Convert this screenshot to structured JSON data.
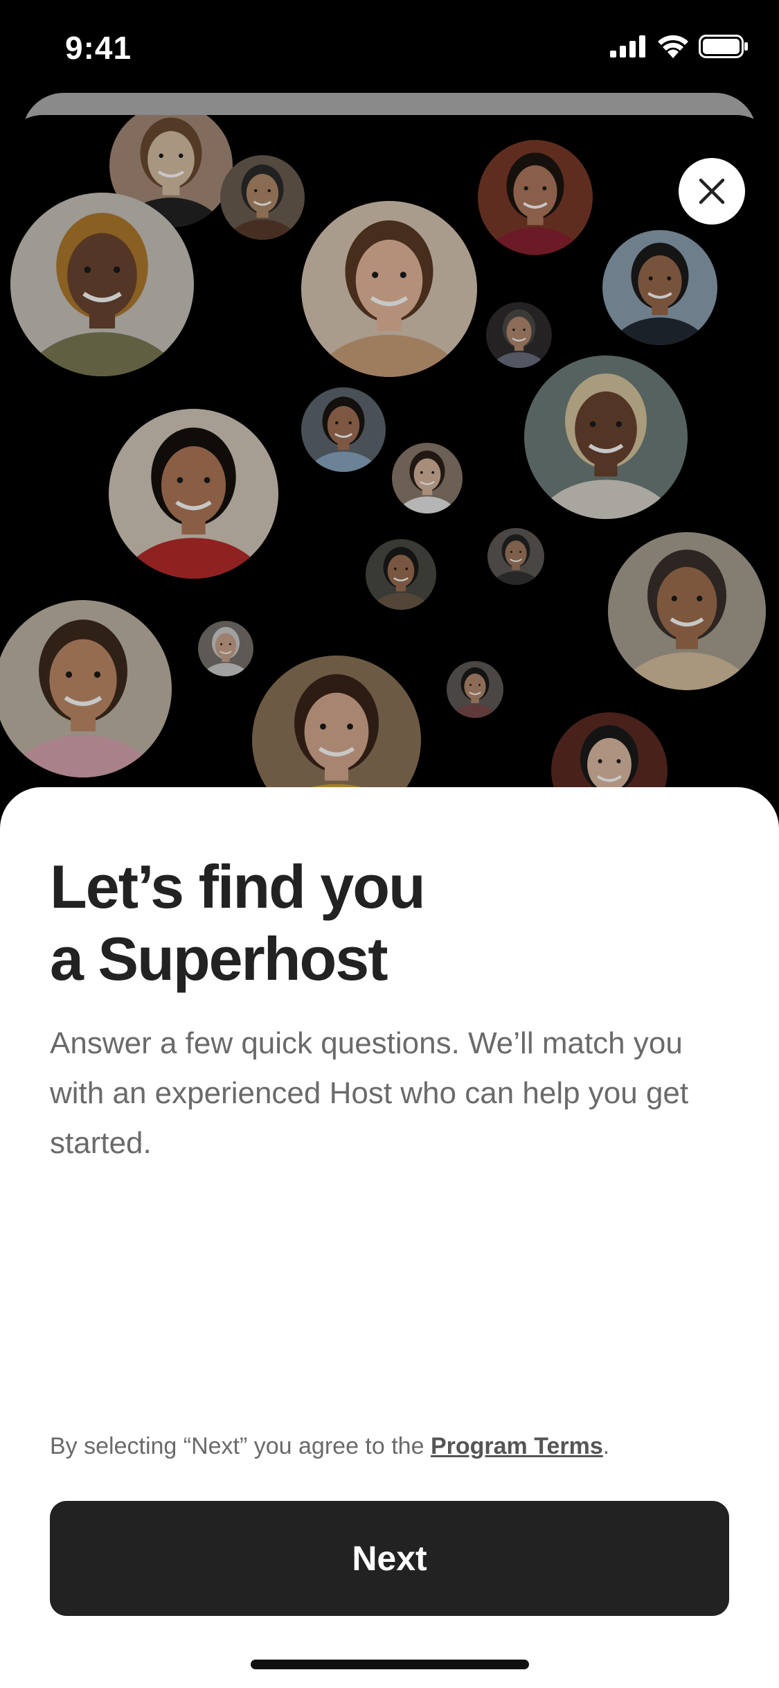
{
  "status_bar": {
    "time": "9:41",
    "icons": [
      "cellular-signal-icon",
      "wifi-icon",
      "battery-icon"
    ]
  },
  "header": {
    "close_icon": "close-icon"
  },
  "gallery": {
    "description_icon": "host-portrait-avatars"
  },
  "content": {
    "title_line1": "Let’s find you",
    "title_line2": "a Superhost",
    "subtitle": "Answer a few quick questions. We’ll match you with an experienced Host who can help you get started."
  },
  "footer": {
    "terms_prefix": "By selecting “Next” you agree to the ",
    "terms_link": "Program Terms",
    "terms_suffix": ".",
    "next_label": "Next"
  },
  "colors": {
    "background": "#000000",
    "panel": "#ffffff",
    "title_text": "#222222",
    "body_text": "#6a6a6a",
    "button": "#222222",
    "button_text": "#ffffff"
  }
}
